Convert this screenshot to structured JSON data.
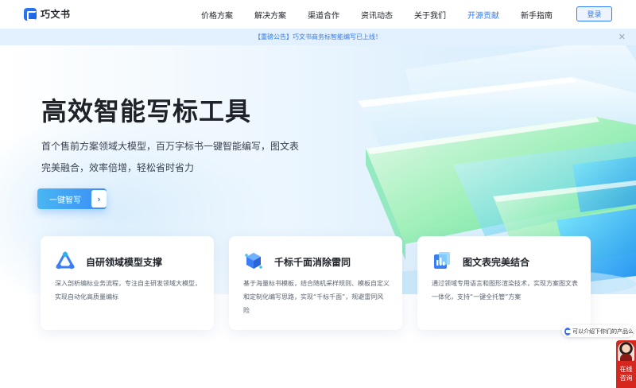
{
  "header": {
    "logo_text": "巧文书",
    "nav": [
      {
        "label": "价格方案"
      },
      {
        "label": "解决方案"
      },
      {
        "label": "渠道合作"
      },
      {
        "label": "资讯动态"
      },
      {
        "label": "关于我们"
      },
      {
        "label": "开源贡献",
        "active": true
      },
      {
        "label": "新手指南"
      }
    ],
    "login_label": "登录"
  },
  "notice": {
    "text": "【重磅公告】巧文书商务标智能编写已上线！",
    "close_icon": "close-icon"
  },
  "hero": {
    "title": "高效智能写标工具",
    "subtitle_line1": "首个售前方案领域大模型，百万字标书一键智能编写，图文表",
    "subtitle_line2": "完美融合，效率倍增，轻松省时省力",
    "cta_label": "一键智写",
    "cta_icon": "chevron-right-icon"
  },
  "features": [
    {
      "icon": "model-triangle-icon",
      "title": "自研领域模型支撑",
      "desc": "深入剖析编标业务流程，专注自主研发领域大模型，实现自动化高质量编标"
    },
    {
      "icon": "cube-icon",
      "title": "千标千面消除雷同",
      "desc": "基于海量标书模板，结合随机采样规则、模板自定义和定制化编写思路，实现“千标千面”，规避雷同风险"
    },
    {
      "icon": "document-chart-icon",
      "title": "图文表完美结合",
      "desc": "通过领域专用语言和图形渲染技术，实现方案图文表一体化，支持“一键全托管”方案"
    }
  ],
  "widgets": {
    "chat_tip": "可以介绍下你们的产品么",
    "consult_line1": "在线",
    "consult_line2": "咨询"
  },
  "colors": {
    "accent": "#2f7cf6",
    "notice_bg": "#e3f0fd",
    "consult_bg": "#d7261e"
  }
}
